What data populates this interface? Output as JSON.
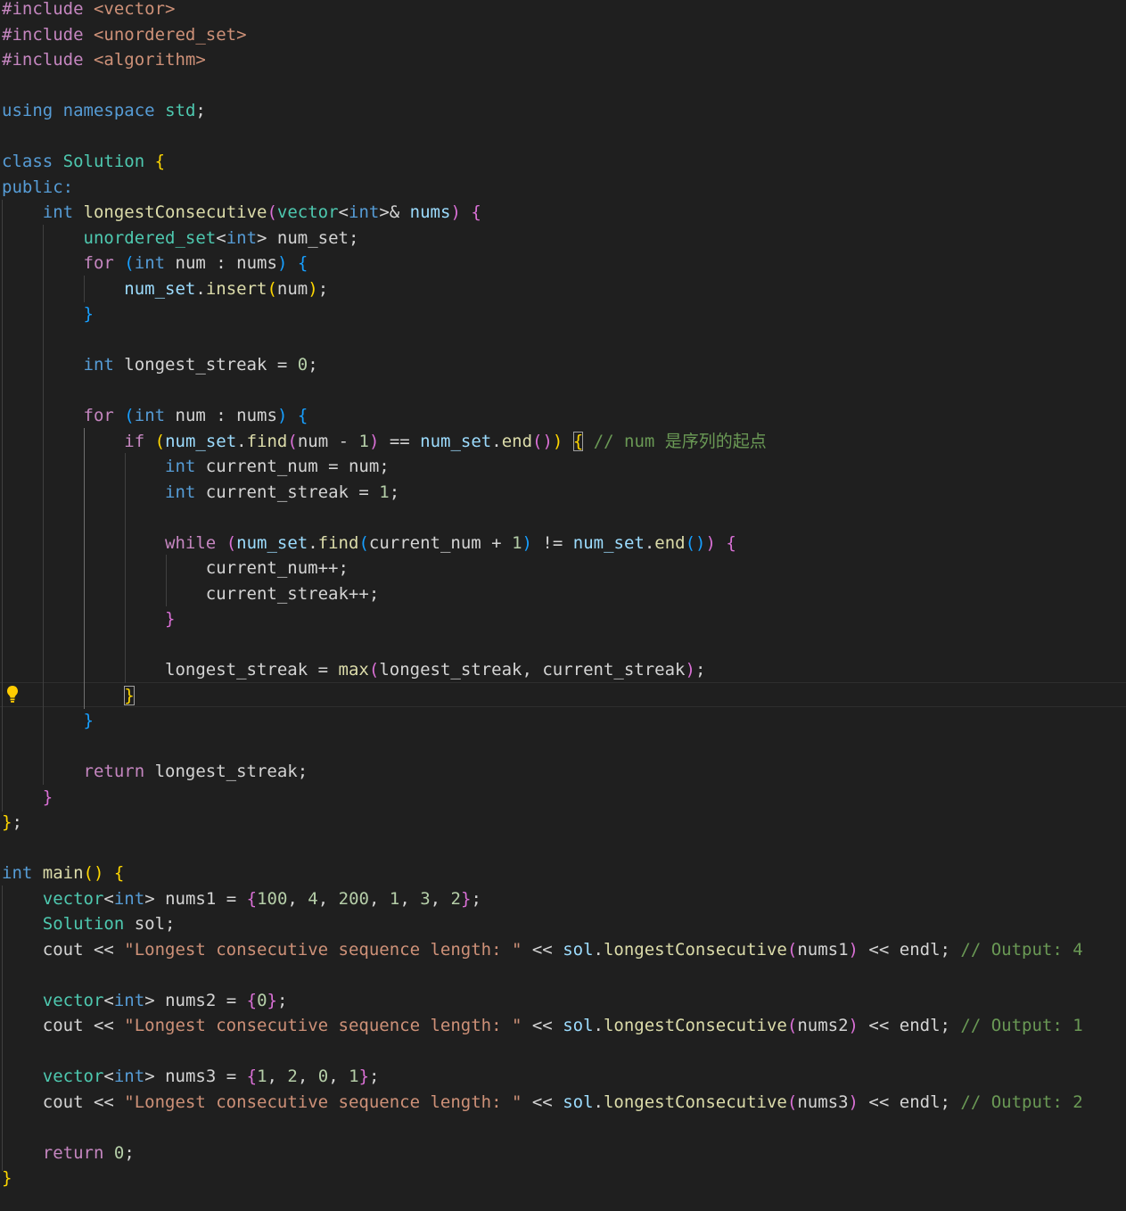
{
  "editor": {
    "language": "cpp",
    "theme_colors": {
      "background": "#1f1f1f",
      "keyword": "#569cd6",
      "control": "#c586c0",
      "type": "#4ec9b0",
      "function": "#dcdcaa",
      "variable": "#9cdcfe",
      "number": "#b5cea8",
      "string": "#ce9178",
      "comment": "#6a9955",
      "bracket_level_1": "#ffd700",
      "bracket_level_2": "#da70d6",
      "bracket_level_3": "#179fff"
    },
    "lightbulb_icon": "lightbulb-icon",
    "lines": [
      [
        [
          "#include",
          "pre"
        ],
        [
          " ",
          "txt"
        ],
        [
          "<vector>",
          "inc"
        ]
      ],
      [
        [
          "#include",
          "pre"
        ],
        [
          " ",
          "txt"
        ],
        [
          "<unordered_set>",
          "inc"
        ]
      ],
      [
        [
          "#include",
          "pre"
        ],
        [
          " ",
          "txt"
        ],
        [
          "<algorithm>",
          "inc"
        ]
      ],
      [],
      [
        [
          "using",
          "kw"
        ],
        [
          " ",
          "txt"
        ],
        [
          "namespace",
          "kw"
        ],
        [
          " ",
          "txt"
        ],
        [
          "std",
          "type"
        ],
        [
          ";",
          "txt"
        ]
      ],
      [],
      [
        [
          "class",
          "kw"
        ],
        [
          " ",
          "txt"
        ],
        [
          "Solution",
          "type"
        ],
        [
          " ",
          "txt"
        ],
        [
          "{",
          "b1"
        ]
      ],
      [
        [
          "public",
          "kw"
        ],
        [
          ":",
          "kw"
        ]
      ],
      [
        [
          "    ",
          "txt"
        ],
        [
          "int",
          "kw"
        ],
        [
          " ",
          "txt"
        ],
        [
          "longestConsecutive",
          "fn"
        ],
        [
          "(",
          "b2"
        ],
        [
          "vector",
          "type"
        ],
        [
          "<",
          "txt"
        ],
        [
          "int",
          "kw"
        ],
        [
          ">&",
          "txt"
        ],
        [
          " ",
          "txt"
        ],
        [
          "nums",
          "var"
        ],
        [
          ")",
          "b2"
        ],
        [
          " ",
          "txt"
        ],
        [
          "{",
          "b2"
        ]
      ],
      [
        [
          "        ",
          "txt"
        ],
        [
          "unordered_set",
          "type"
        ],
        [
          "<",
          "txt"
        ],
        [
          "int",
          "kw"
        ],
        [
          "> ",
          "txt"
        ],
        [
          "num_set",
          "txt"
        ],
        [
          ";",
          "txt"
        ]
      ],
      [
        [
          "        ",
          "txt"
        ],
        [
          "for",
          "ctl"
        ],
        [
          " ",
          "txt"
        ],
        [
          "(",
          "b3"
        ],
        [
          "int",
          "kw"
        ],
        [
          " num ",
          "txt"
        ],
        [
          ":",
          "txt"
        ],
        [
          " nums",
          "txt"
        ],
        [
          ")",
          "b3"
        ],
        [
          " ",
          "txt"
        ],
        [
          "{",
          "b3"
        ]
      ],
      [
        [
          "            ",
          "txt"
        ],
        [
          "num_set",
          "var"
        ],
        [
          ".",
          "txt"
        ],
        [
          "insert",
          "fn"
        ],
        [
          "(",
          "b1"
        ],
        [
          "num",
          "txt"
        ],
        [
          ")",
          "b1"
        ],
        [
          ";",
          "txt"
        ]
      ],
      [
        [
          "        ",
          "txt"
        ],
        [
          "}",
          "b3"
        ]
      ],
      [],
      [
        [
          "        ",
          "txt"
        ],
        [
          "int",
          "kw"
        ],
        [
          " longest_streak ",
          "txt"
        ],
        [
          "=",
          "txt"
        ],
        [
          " ",
          "txt"
        ],
        [
          "0",
          "num"
        ],
        [
          ";",
          "txt"
        ]
      ],
      [],
      [
        [
          "        ",
          "txt"
        ],
        [
          "for",
          "ctl"
        ],
        [
          " ",
          "txt"
        ],
        [
          "(",
          "b3"
        ],
        [
          "int",
          "kw"
        ],
        [
          " num ",
          "txt"
        ],
        [
          ":",
          "txt"
        ],
        [
          " nums",
          "txt"
        ],
        [
          ")",
          "b3"
        ],
        [
          " ",
          "txt"
        ],
        [
          "{",
          "b3"
        ]
      ],
      [
        [
          "            ",
          "txt"
        ],
        [
          "if",
          "ctl"
        ],
        [
          " ",
          "txt"
        ],
        [
          "(",
          "b1"
        ],
        [
          "num_set",
          "var"
        ],
        [
          ".",
          "txt"
        ],
        [
          "find",
          "fn"
        ],
        [
          "(",
          "b2"
        ],
        [
          "num ",
          "txt"
        ],
        [
          "-",
          "txt"
        ],
        [
          " ",
          "txt"
        ],
        [
          "1",
          "num"
        ],
        [
          ")",
          "b2"
        ],
        [
          " == ",
          "txt"
        ],
        [
          "num_set",
          "var"
        ],
        [
          ".",
          "txt"
        ],
        [
          "end",
          "fn"
        ],
        [
          "()",
          "b2"
        ],
        [
          ")",
          "b1"
        ],
        [
          " ",
          "txt"
        ],
        [
          "{",
          "b1",
          "bm"
        ],
        [
          " ",
          "txt"
        ],
        [
          "// num 是序列的起点",
          "com"
        ]
      ],
      [
        [
          "                ",
          "txt"
        ],
        [
          "int",
          "kw"
        ],
        [
          " current_num ",
          "txt"
        ],
        [
          "=",
          "txt"
        ],
        [
          " num",
          "txt"
        ],
        [
          ";",
          "txt"
        ]
      ],
      [
        [
          "                ",
          "txt"
        ],
        [
          "int",
          "kw"
        ],
        [
          " current_streak ",
          "txt"
        ],
        [
          "=",
          "txt"
        ],
        [
          " ",
          "txt"
        ],
        [
          "1",
          "num"
        ],
        [
          ";",
          "txt"
        ]
      ],
      [],
      [
        [
          "                ",
          "txt"
        ],
        [
          "while",
          "ctl"
        ],
        [
          " ",
          "txt"
        ],
        [
          "(",
          "b2"
        ],
        [
          "num_set",
          "var"
        ],
        [
          ".",
          "txt"
        ],
        [
          "find",
          "fn"
        ],
        [
          "(",
          "b3"
        ],
        [
          "current_num ",
          "txt"
        ],
        [
          "+",
          "txt"
        ],
        [
          " ",
          "txt"
        ],
        [
          "1",
          "num"
        ],
        [
          ")",
          "b3"
        ],
        [
          " != ",
          "txt"
        ],
        [
          "num_set",
          "var"
        ],
        [
          ".",
          "txt"
        ],
        [
          "end",
          "fn"
        ],
        [
          "()",
          "b3"
        ],
        [
          ")",
          "b2"
        ],
        [
          " ",
          "txt"
        ],
        [
          "{",
          "b2"
        ]
      ],
      [
        [
          "                    ",
          "txt"
        ],
        [
          "current_num++",
          "txt"
        ],
        [
          ";",
          "txt"
        ]
      ],
      [
        [
          "                    ",
          "txt"
        ],
        [
          "current_streak++",
          "txt"
        ],
        [
          ";",
          "txt"
        ]
      ],
      [
        [
          "                ",
          "txt"
        ],
        [
          "}",
          "b2"
        ]
      ],
      [],
      [
        [
          "                ",
          "txt"
        ],
        [
          "longest_streak ",
          "txt"
        ],
        [
          "=",
          "txt"
        ],
        [
          " ",
          "txt"
        ],
        [
          "max",
          "fn"
        ],
        [
          "(",
          "b2"
        ],
        [
          "longest_streak, current_streak",
          "txt"
        ],
        [
          ")",
          "b2"
        ],
        [
          ";",
          "txt"
        ]
      ],
      [
        [
          "            ",
          "txt"
        ],
        [
          "}",
          "b1",
          "bm"
        ]
      ],
      [
        [
          "        ",
          "txt"
        ],
        [
          "}",
          "b3"
        ]
      ],
      [],
      [
        [
          "        ",
          "txt"
        ],
        [
          "return",
          "ctl"
        ],
        [
          " longest_streak",
          "txt"
        ],
        [
          ";",
          "txt"
        ]
      ],
      [
        [
          "    ",
          "txt"
        ],
        [
          "}",
          "b2"
        ]
      ],
      [
        [
          "}",
          "b1"
        ],
        [
          ";",
          "txt"
        ]
      ],
      [],
      [
        [
          "int",
          "kw"
        ],
        [
          " ",
          "txt"
        ],
        [
          "main",
          "fn"
        ],
        [
          "()",
          "b1"
        ],
        [
          " ",
          "txt"
        ],
        [
          "{",
          "b1"
        ]
      ],
      [
        [
          "    ",
          "txt"
        ],
        [
          "vector",
          "type"
        ],
        [
          "<",
          "txt"
        ],
        [
          "int",
          "kw"
        ],
        [
          "> ",
          "txt"
        ],
        [
          "nums1 ",
          "txt"
        ],
        [
          "=",
          "txt"
        ],
        [
          " ",
          "txt"
        ],
        [
          "{",
          "b2"
        ],
        [
          "100",
          "num"
        ],
        [
          ", ",
          "txt"
        ],
        [
          "4",
          "num"
        ],
        [
          ", ",
          "txt"
        ],
        [
          "200",
          "num"
        ],
        [
          ", ",
          "txt"
        ],
        [
          "1",
          "num"
        ],
        [
          ", ",
          "txt"
        ],
        [
          "3",
          "num"
        ],
        [
          ", ",
          "txt"
        ],
        [
          "2",
          "num"
        ],
        [
          "}",
          "b2"
        ],
        [
          ";",
          "txt"
        ]
      ],
      [
        [
          "    ",
          "txt"
        ],
        [
          "Solution",
          "type"
        ],
        [
          " sol",
          "txt"
        ],
        [
          ";",
          "txt"
        ]
      ],
      [
        [
          "    ",
          "txt"
        ],
        [
          "cout",
          "txt"
        ],
        [
          " << ",
          "txt"
        ],
        [
          "\"Longest consecutive sequence length: \"",
          "str"
        ],
        [
          " << ",
          "txt"
        ],
        [
          "sol",
          "var"
        ],
        [
          ".",
          "txt"
        ],
        [
          "longestConsecutive",
          "fn"
        ],
        [
          "(",
          "b2"
        ],
        [
          "nums1",
          "txt"
        ],
        [
          ")",
          "b2"
        ],
        [
          " << ",
          "txt"
        ],
        [
          "endl",
          "txt"
        ],
        [
          ";",
          "txt"
        ],
        [
          " ",
          "txt"
        ],
        [
          "// Output: 4",
          "com"
        ]
      ],
      [],
      [
        [
          "    ",
          "txt"
        ],
        [
          "vector",
          "type"
        ],
        [
          "<",
          "txt"
        ],
        [
          "int",
          "kw"
        ],
        [
          "> ",
          "txt"
        ],
        [
          "nums2 ",
          "txt"
        ],
        [
          "=",
          "txt"
        ],
        [
          " ",
          "txt"
        ],
        [
          "{",
          "b2"
        ],
        [
          "0",
          "num"
        ],
        [
          "}",
          "b2"
        ],
        [
          ";",
          "txt"
        ]
      ],
      [
        [
          "    ",
          "txt"
        ],
        [
          "cout",
          "txt"
        ],
        [
          " << ",
          "txt"
        ],
        [
          "\"Longest consecutive sequence length: \"",
          "str"
        ],
        [
          " << ",
          "txt"
        ],
        [
          "sol",
          "var"
        ],
        [
          ".",
          "txt"
        ],
        [
          "longestConsecutive",
          "fn"
        ],
        [
          "(",
          "b2"
        ],
        [
          "nums2",
          "txt"
        ],
        [
          ")",
          "b2"
        ],
        [
          " << ",
          "txt"
        ],
        [
          "endl",
          "txt"
        ],
        [
          ";",
          "txt"
        ],
        [
          " ",
          "txt"
        ],
        [
          "// Output: 1",
          "com"
        ]
      ],
      [],
      [
        [
          "    ",
          "txt"
        ],
        [
          "vector",
          "type"
        ],
        [
          "<",
          "txt"
        ],
        [
          "int",
          "kw"
        ],
        [
          "> ",
          "txt"
        ],
        [
          "nums3 ",
          "txt"
        ],
        [
          "=",
          "txt"
        ],
        [
          " ",
          "txt"
        ],
        [
          "{",
          "b2"
        ],
        [
          "1",
          "num"
        ],
        [
          ", ",
          "txt"
        ],
        [
          "2",
          "num"
        ],
        [
          ", ",
          "txt"
        ],
        [
          "0",
          "num"
        ],
        [
          ", ",
          "txt"
        ],
        [
          "1",
          "num"
        ],
        [
          "}",
          "b2"
        ],
        [
          ";",
          "txt"
        ]
      ],
      [
        [
          "    ",
          "txt"
        ],
        [
          "cout",
          "txt"
        ],
        [
          " << ",
          "txt"
        ],
        [
          "\"Longest consecutive sequence length: \"",
          "str"
        ],
        [
          " << ",
          "txt"
        ],
        [
          "sol",
          "var"
        ],
        [
          ".",
          "txt"
        ],
        [
          "longestConsecutive",
          "fn"
        ],
        [
          "(",
          "b2"
        ],
        [
          "nums3",
          "txt"
        ],
        [
          ")",
          "b2"
        ],
        [
          " << ",
          "txt"
        ],
        [
          "endl",
          "txt"
        ],
        [
          ";",
          "txt"
        ],
        [
          " ",
          "txt"
        ],
        [
          "// Output: 2",
          "com"
        ]
      ],
      [],
      [
        [
          "    ",
          "txt"
        ],
        [
          "return",
          "ctl"
        ],
        [
          " ",
          "txt"
        ],
        [
          "0",
          "num"
        ],
        [
          ";",
          "txt"
        ]
      ],
      [
        [
          "}",
          "b1"
        ]
      ]
    ]
  }
}
